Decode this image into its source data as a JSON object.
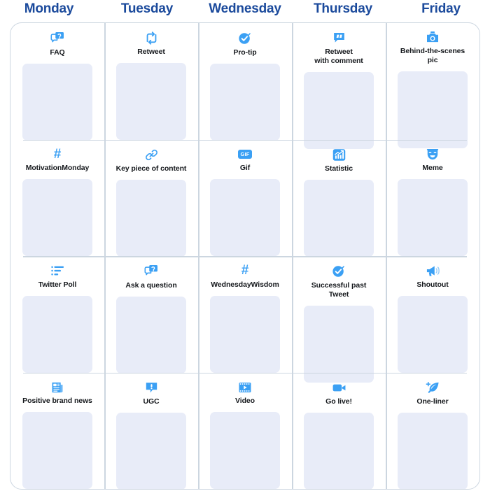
{
  "header": {
    "days": [
      "Monday",
      "Tuesday",
      "Wednesday",
      "Thursday",
      "Friday"
    ]
  },
  "colors": {
    "day_header_blue": "#1b4a9c",
    "icon_blue": "#3ba0f4",
    "placeholder_fill": "#e8ecf8",
    "grid_line": "#ccd6e0",
    "label_text": "#15181c",
    "card_background": "#ffffff"
  },
  "grid": {
    "columns": 5,
    "rows": 4,
    "cells": [
      [
        {
          "label": "FAQ",
          "icon": "speech-bubble-question-icon"
        },
        {
          "label": "Retweet",
          "icon": "retweet-icon"
        },
        {
          "label": "Pro-tip",
          "icon": "verified-check-badge-icon"
        },
        {
          "label": "Retweet\nwith comment",
          "icon": "quote-bubble-icon"
        },
        {
          "label": "Behind-the-scenes\npic",
          "icon": "camera-icon"
        }
      ],
      [
        {
          "label": "MotivationMonday",
          "icon": "hashtag-icon"
        },
        {
          "label": "Key piece of content",
          "icon": "link-chain-icon"
        },
        {
          "label": "Gif",
          "icon": "gif-badge-icon"
        },
        {
          "label": "Statistic",
          "icon": "chart-growth-icon"
        },
        {
          "label": "Meme",
          "icon": "theater-mask-icon"
        }
      ],
      [
        {
          "label": "Twitter Poll",
          "icon": "poll-list-icon"
        },
        {
          "label": "Ask a question",
          "icon": "speech-bubble-question-icon"
        },
        {
          "label": "WednesdayWisdom",
          "icon": "hashtag-icon"
        },
        {
          "label": "Successful past\nTweet",
          "icon": "verified-check-badge-icon"
        },
        {
          "label": "Shoutout",
          "icon": "megaphone-icon"
        }
      ],
      [
        {
          "label": "Positive brand news",
          "icon": "newspaper-icon"
        },
        {
          "label": "UGC",
          "icon": "speech-bubble-exclamation-icon"
        },
        {
          "label": "Video",
          "icon": "film-strip-play-icon"
        },
        {
          "label": "Go live!",
          "icon": "video-camera-icon"
        },
        {
          "label": "One-liner",
          "icon": "quill-plus-icon"
        }
      ]
    ]
  }
}
